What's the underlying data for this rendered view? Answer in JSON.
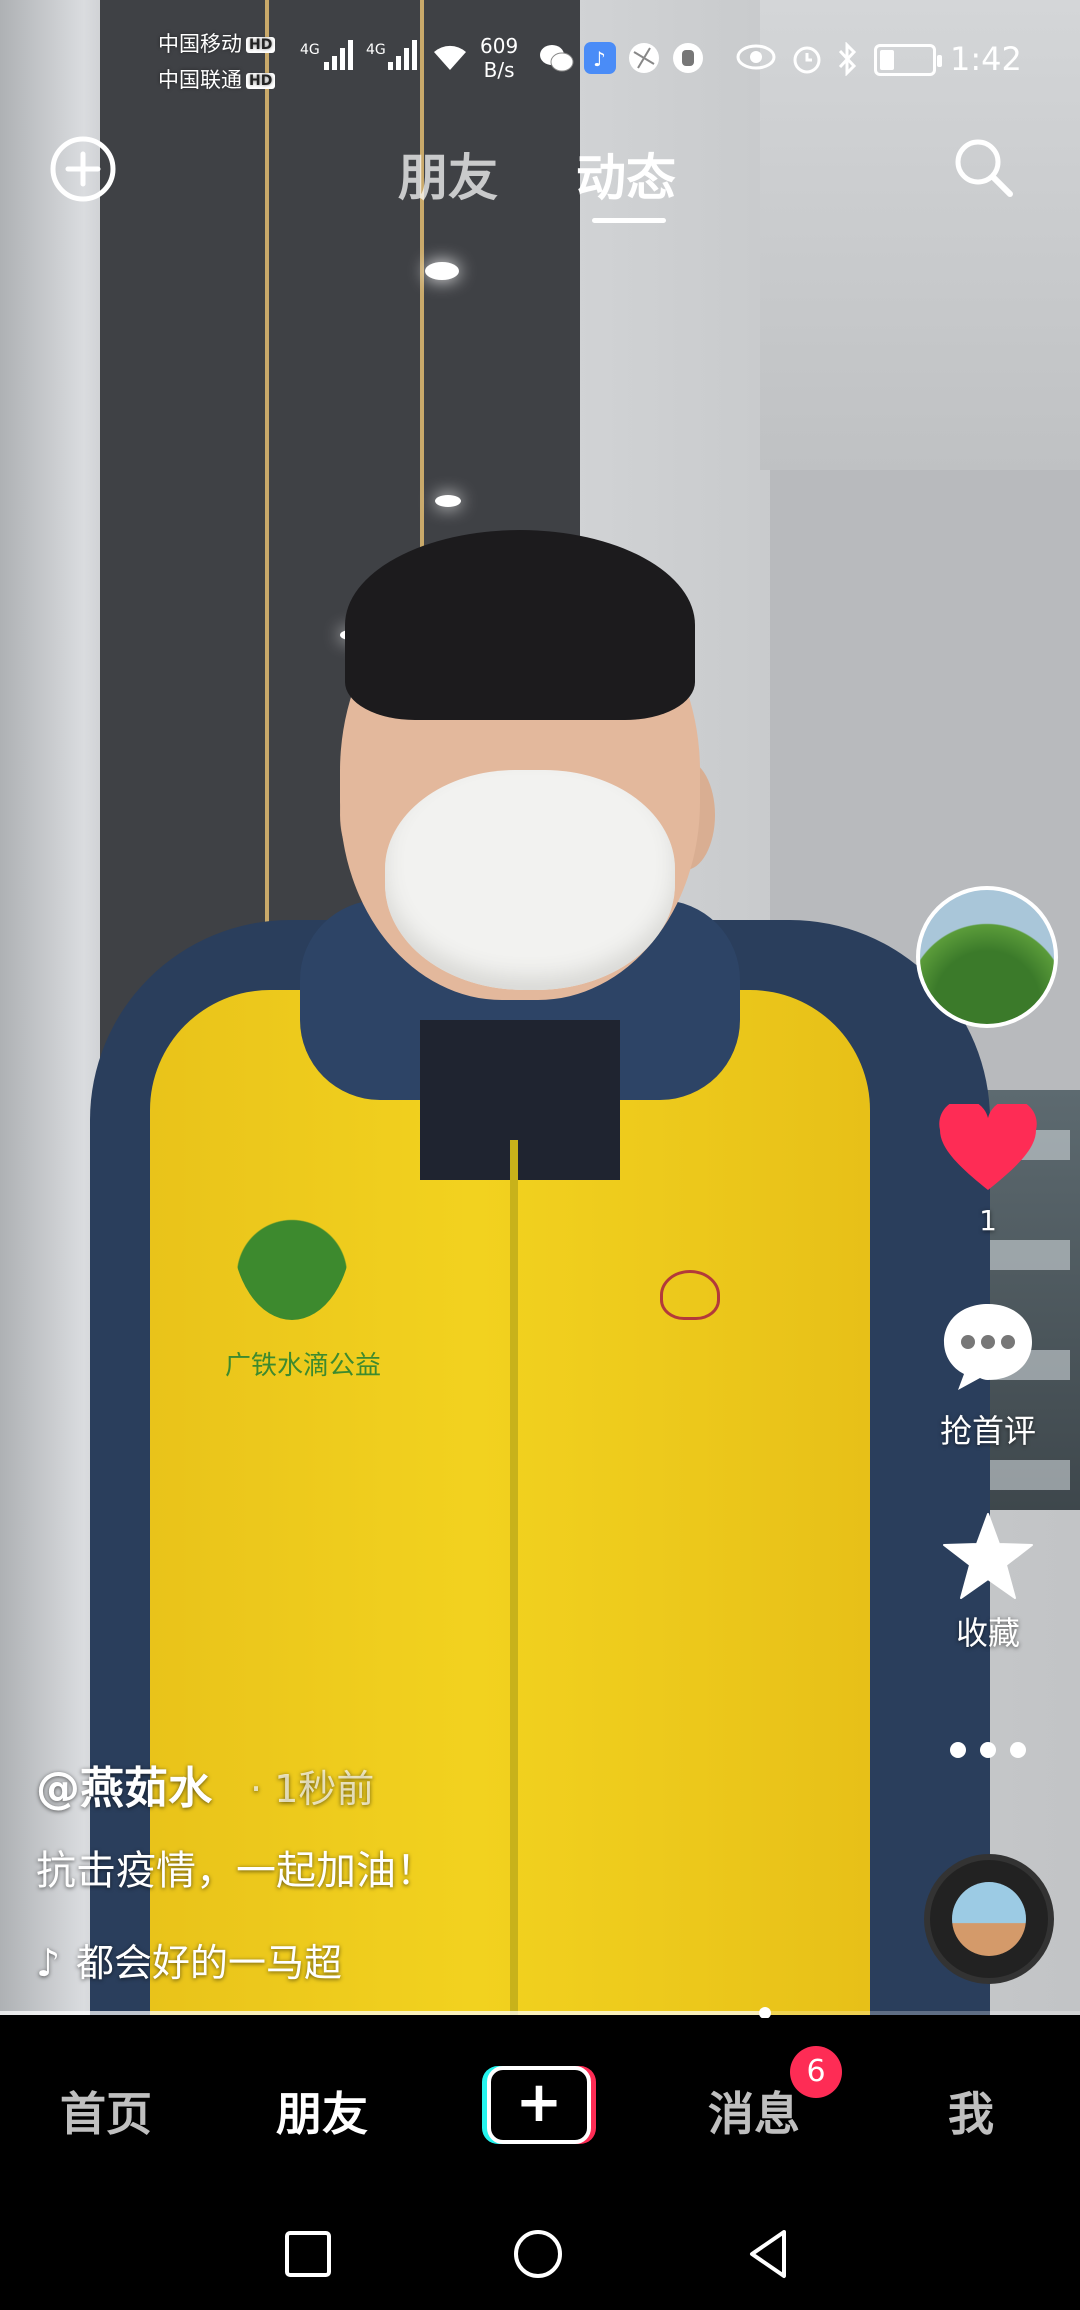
{
  "status_bar": {
    "carrier1": "中国移动",
    "carrier2": "中国联通",
    "hd_badge": "HD",
    "net_type": "4G",
    "net_speed_value": "609",
    "net_speed_unit": "B/s",
    "time": "1:42"
  },
  "top_nav": {
    "tabs": [
      {
        "label": "朋友",
        "active": false
      },
      {
        "label": "动态",
        "active": true
      }
    ]
  },
  "right_rail": {
    "like_count": "1",
    "comment_label": "抢首评",
    "favorite_label": "收藏"
  },
  "post": {
    "author": "@燕茹水",
    "time_ago": "1秒前",
    "separator": "·",
    "description": "抗击疫情，一起加油！",
    "music": "都会好的一马超",
    "vest_logo_text": "广铁水滴公益"
  },
  "playback": {
    "progress": 0.708
  },
  "bottom_nav": {
    "items": [
      {
        "label": "首页",
        "active": false
      },
      {
        "label": "朋友",
        "active": true
      },
      {
        "label": "消息",
        "active": false
      },
      {
        "label": "我",
        "active": false
      }
    ],
    "create_label": "+",
    "message_badge": "6"
  },
  "colors": {
    "accent_red": "#fe2c55",
    "accent_cyan": "#25f4ee",
    "like_heart": "#fe2c55"
  }
}
